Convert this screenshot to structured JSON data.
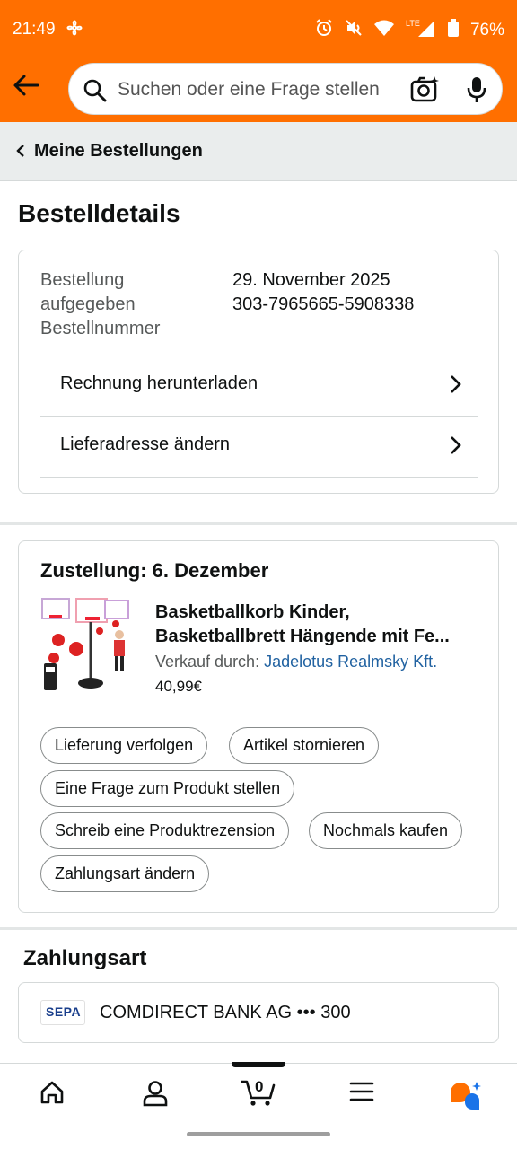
{
  "status_bar": {
    "time": "21:49",
    "battery": "76%",
    "network": "LTE"
  },
  "search": {
    "placeholder": "Suchen oder eine Frage stellen"
  },
  "nav": {
    "back_label": "Meine Bestellungen"
  },
  "page": {
    "title": "Bestelldetails"
  },
  "order": {
    "label_placed_1": "Bestellung",
    "label_placed_2": "aufgegeben",
    "label_number": "Bestellnummer",
    "date": "29. November 2025",
    "number": "303-7965665-5908338",
    "link_invoice": "Rechnung herunterladen",
    "link_address": "Lieferadresse ändern"
  },
  "shipment": {
    "delivery": "Zustellung: 6. Dezember",
    "product_title_line1": "Basketballkorb Kinder,",
    "product_title_line2": "Basketballbrett Hängende mit Fe...",
    "seller_prefix": "Verkauf durch: ",
    "seller_name": "Jadelotus Realmsky Kft.",
    "price": "40,99€",
    "actions": {
      "track": "Lieferung verfolgen",
      "cancel": "Artikel stornieren",
      "question": "Eine Frage zum Produkt stellen",
      "review": "Schreib eine Produktrezension",
      "buy_again": "Nochmals kaufen",
      "change_payment": "Zahlungsart ändern"
    }
  },
  "payment": {
    "title": "Zahlungsart",
    "logo_text": "SEPA",
    "bank": "COMDIRECT BANK AG ••• 300"
  },
  "bottom_nav": {
    "cart_count": "0",
    "icons": [
      "home-icon",
      "account-icon",
      "cart-icon",
      "menu-icon",
      "rufus-icon"
    ]
  },
  "colors": {
    "header": "#ff6f00",
    "link": "#2162a1",
    "nav_bg": "#eaeded"
  }
}
